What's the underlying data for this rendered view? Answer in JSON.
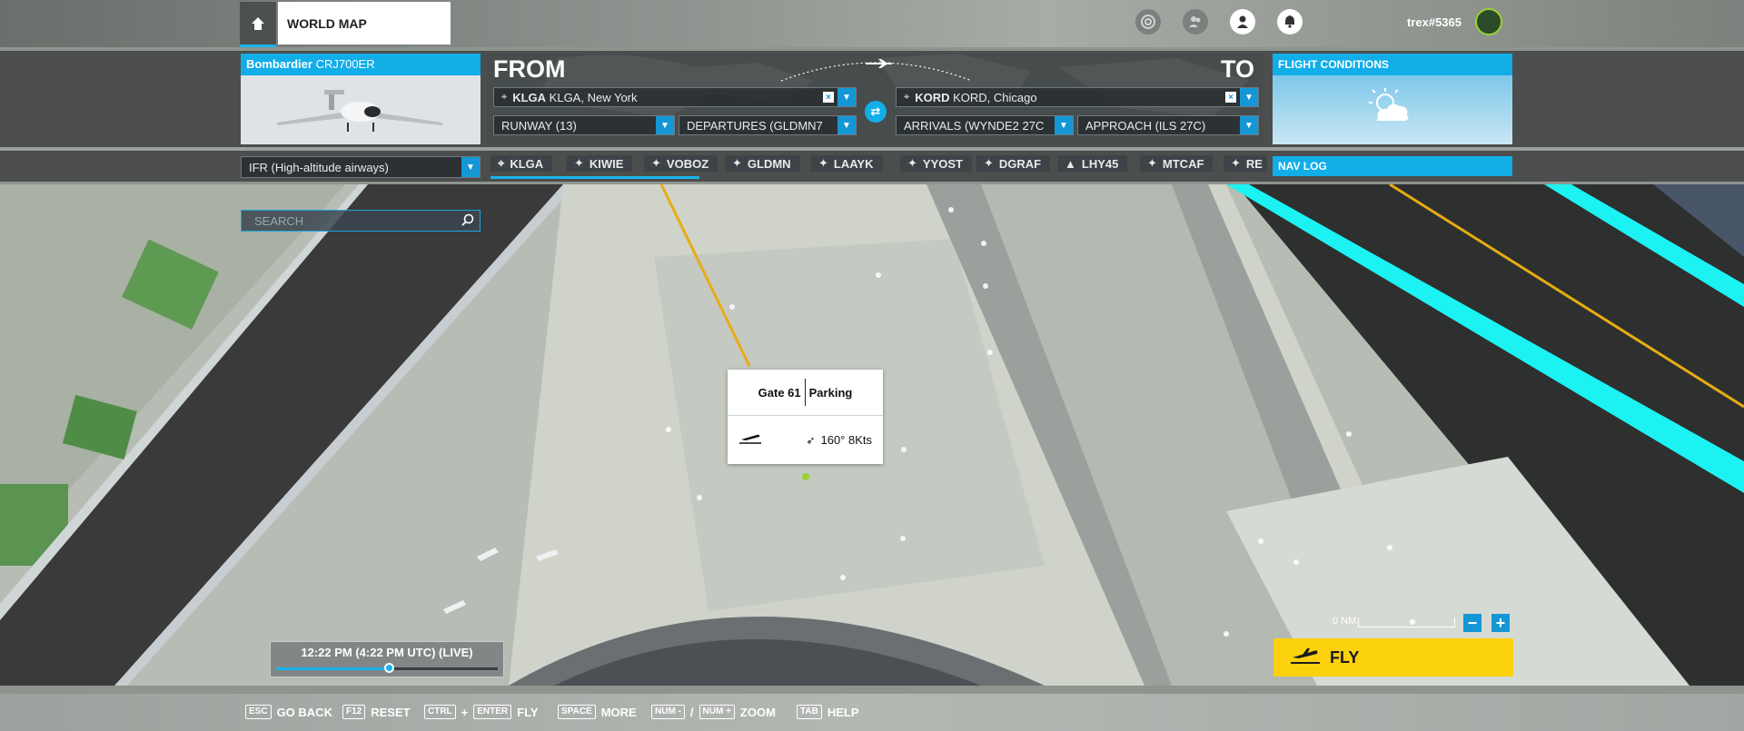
{
  "header": {
    "tab_label": "WORLD MAP",
    "username": "trex#5365",
    "icons": [
      "achievements-icon",
      "friends-icon",
      "profile-icon",
      "notifications-icon"
    ]
  },
  "aircraft": {
    "make": "Bombardier",
    "model": "CRJ700ER"
  },
  "from": {
    "title": "FROM",
    "airport_code": "KLGA",
    "airport_name": "KLGA, New York",
    "runway": "RUNWAY (13)",
    "departure": "DEPARTURES (GLDMN7"
  },
  "to": {
    "title": "TO",
    "airport_code": "KORD",
    "airport_name": "KORD, Chicago",
    "arrival": "ARRIVALS (WYNDE2 27C",
    "approach": "APPROACH (ILS 27C)"
  },
  "flight_conditions": {
    "title": "FLIGHT CONDITIONS"
  },
  "flight_plan": {
    "type": "IFR (High-altitude airways)"
  },
  "nav_log": {
    "title": "NAV LOG"
  },
  "waypoints": [
    {
      "icon": "airport-icon",
      "label": "KLGA"
    },
    {
      "icon": "waypoint-icon",
      "label": "KIWIE"
    },
    {
      "icon": "waypoint-icon",
      "label": "VOBOZ"
    },
    {
      "icon": "waypoint-icon",
      "label": "GLDMN"
    },
    {
      "icon": "waypoint-icon",
      "label": "LAAYK"
    },
    {
      "icon": "waypoint-icon",
      "label": "YYOST"
    },
    {
      "icon": "waypoint-icon",
      "label": "DGRAF"
    },
    {
      "icon": "vor-icon",
      "label": "LHY45"
    },
    {
      "icon": "waypoint-icon",
      "label": "MTCAF"
    },
    {
      "icon": "waypoint-icon",
      "label": "RE"
    }
  ],
  "search": {
    "placeholder": "SEARCH"
  },
  "popup": {
    "gate": "Gate 61",
    "type": "Parking",
    "wind": "160° 8Kts"
  },
  "time": {
    "display": "12:22 PM (4:22 PM UTC) (LIVE)",
    "slider_fraction": 0.51
  },
  "map": {
    "scale_label": "0 NM"
  },
  "fly_button": {
    "label": "FLY"
  },
  "footer": {
    "hints": [
      {
        "keys": [
          "ESC"
        ],
        "label": "GO BACK"
      },
      {
        "keys": [
          "F12"
        ],
        "label": "RESET"
      },
      {
        "keys": [
          "CTRL",
          "ENTER"
        ],
        "label": "FLY"
      },
      {
        "keys": [
          "SPACE"
        ],
        "label": "MORE"
      },
      {
        "keys": [
          "NUM -",
          "NUM +"
        ],
        "label": "ZOOM"
      },
      {
        "keys": [
          "TAB"
        ],
        "label": "HELP"
      }
    ],
    "plus": "+",
    "slash": "/"
  },
  "colors": {
    "accent": "#11aee8",
    "fly": "#fcd10e",
    "route": "#e6ac12",
    "runway_highlight": "#1cf2f2"
  }
}
